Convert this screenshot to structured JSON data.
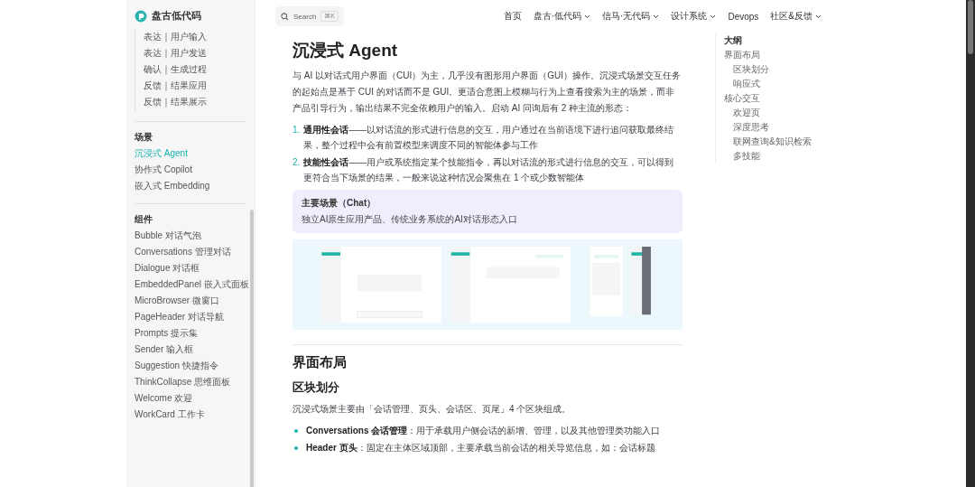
{
  "sidebar": {
    "logo_text": "盘古低代码",
    "sub_items": [
      {
        "label": "表达｜用户输入"
      },
      {
        "label": "表达｜用户发送"
      },
      {
        "label": "确认｜生成过程"
      },
      {
        "label": "反馈｜结果应用"
      },
      {
        "label": "反馈｜结果展示"
      }
    ],
    "sections": [
      {
        "title": "场景",
        "items": [
          {
            "label": "沉浸式 Agent",
            "selected": true
          },
          {
            "label": "协作式 Copilot",
            "selected": false
          },
          {
            "label": "嵌入式 Embedding",
            "selected": false
          }
        ]
      },
      {
        "title": "组件",
        "items": [
          {
            "label": "Bubble 对话气泡",
            "selected": false
          },
          {
            "label": "Conversations 管理对话",
            "selected": false
          },
          {
            "label": "Dialogue 对话框",
            "selected": false
          },
          {
            "label": "EmbeddedPanel 嵌入式面板",
            "selected": false
          },
          {
            "label": "MicroBrowser 微窗口",
            "selected": false
          },
          {
            "label": "PageHeader 对话导航",
            "selected": false
          },
          {
            "label": "Prompts 提示集",
            "selected": false
          },
          {
            "label": "Sender 输入框",
            "selected": false
          },
          {
            "label": "Suggestion 快捷指令",
            "selected": false
          },
          {
            "label": "ThinkCollapse 思维面板",
            "selected": false
          },
          {
            "label": "Welcome 欢迎",
            "selected": false
          },
          {
            "label": "WorkCard 工作卡",
            "selected": false
          }
        ]
      }
    ]
  },
  "header": {
    "search": {
      "placeholder": "Search",
      "shortcut": "⌘K"
    },
    "nav": [
      {
        "label": "首页",
        "dropdown": false
      },
      {
        "label": "盘古·低代码",
        "dropdown": true
      },
      {
        "label": "信马·无代码",
        "dropdown": true
      },
      {
        "label": "设计系统",
        "dropdown": true
      },
      {
        "label": "Devops",
        "dropdown": false
      },
      {
        "label": "社区&反馈",
        "dropdown": true
      }
    ]
  },
  "article": {
    "title": "沉浸式 Agent",
    "intro": "与 AI 以对话式用户界面（CUI）为主，几乎没有图形用户界面（GUI）操作。沉浸式场景交互任务的起始点是基于 CUI 的对话而不是 GUI。更适合意图上模糊与行为上查看搜索为主的场景，而非产品引导行为，输出结果不完全依赖用户的输入。启动 AI 问询后有 2 种主流的形态：",
    "forms": [
      {
        "number": "1.",
        "text": "**通用性会话**——以对话流的形式进行信息的交互，用户通过在当前语境下进行追问获取最终结果，整个过程中会有前置模型来调度不同的智能体参与工作"
      },
      {
        "number": "2.",
        "text": "**技能性会话**——用户或系统指定某个技能指令，再以对话流的形式进行信息的交互，可以得到更符合当下场景的结果，一般来说这种情况会聚焦在 1 个或少数智能体"
      }
    ],
    "callout": {
      "title": "主要场景（Chat）",
      "text": "独立AI原生应用产品、传统业务系统的AI对话形态入口"
    },
    "h2": "界面布局",
    "h3": "区块划分",
    "paragraph": "沉浸式场景主要由「会话管理、页头、会话区、页尾」4 个区块组成。",
    "bullets": [
      {
        "text": "**Conversations 会话管理**：用于承载用户侧会话的新增、管理，以及其他管理类功能入口"
      },
      {
        "text": "**Header 页头**：固定在主体区域顶部，主要承载当前会话的相关导览信息，如：会话标题"
      }
    ]
  },
  "outline": {
    "title": "大纲",
    "items": [
      {
        "label": "界面布局",
        "children": [
          {
            "label": "区块划分"
          },
          {
            "label": "响应式"
          }
        ]
      },
      {
        "label": "核心交互",
        "children": [
          {
            "label": "欢迎页"
          },
          {
            "label": "深度思考"
          },
          {
            "label": "联网查询&知识检索"
          },
          {
            "label": "多技能"
          }
        ]
      }
    ]
  }
}
